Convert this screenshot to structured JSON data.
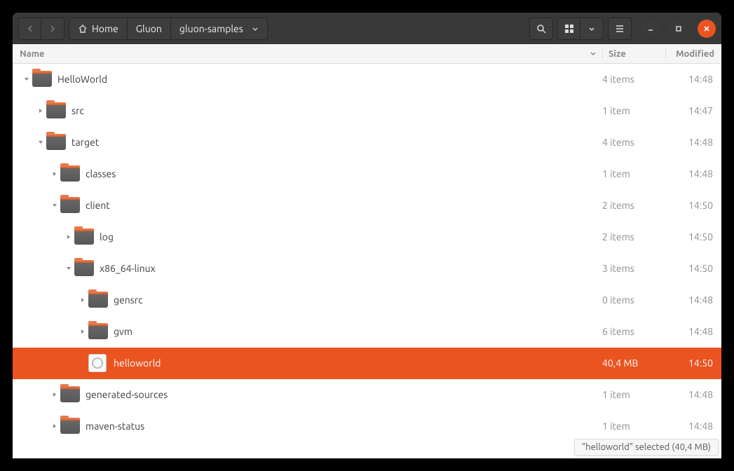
{
  "breadcrumb": {
    "home": "Home",
    "seg1": "Gluon",
    "seg2": "gluon-samples"
  },
  "columns": {
    "name": "Name",
    "size": "Size",
    "modified": "Modified"
  },
  "rows": [
    {
      "indent": 0,
      "expander": "down",
      "icon": "folder",
      "name": "HelloWorld",
      "size": "4 items",
      "mod": "14:48",
      "selected": false
    },
    {
      "indent": 1,
      "expander": "right",
      "icon": "folder",
      "name": "src",
      "size": "1 item",
      "mod": "14:47",
      "selected": false
    },
    {
      "indent": 1,
      "expander": "down",
      "icon": "folder",
      "name": "target",
      "size": "4 items",
      "mod": "14:48",
      "selected": false
    },
    {
      "indent": 2,
      "expander": "right",
      "icon": "folder",
      "name": "classes",
      "size": "1 item",
      "mod": "14:48",
      "selected": false
    },
    {
      "indent": 2,
      "expander": "down",
      "icon": "folder",
      "name": "client",
      "size": "2 items",
      "mod": "14:50",
      "selected": false
    },
    {
      "indent": 3,
      "expander": "right",
      "icon": "folder",
      "name": "log",
      "size": "2 items",
      "mod": "14:50",
      "selected": false
    },
    {
      "indent": 3,
      "expander": "down",
      "icon": "folder",
      "name": "x86_64-linux",
      "size": "3 items",
      "mod": "14:50",
      "selected": false
    },
    {
      "indent": 4,
      "expander": "right",
      "icon": "folder",
      "name": "gensrc",
      "size": "0 items",
      "mod": "14:48",
      "selected": false
    },
    {
      "indent": 4,
      "expander": "right",
      "icon": "folder",
      "name": "gvm",
      "size": "6 items",
      "mod": "14:48",
      "selected": false
    },
    {
      "indent": 4,
      "expander": "none",
      "icon": "exec",
      "name": "helloworld",
      "size": "40,4 MB",
      "mod": "14:50",
      "selected": true
    },
    {
      "indent": 2,
      "expander": "right",
      "icon": "folder",
      "name": "generated-sources",
      "size": "1 item",
      "mod": "14:48",
      "selected": false
    },
    {
      "indent": 2,
      "expander": "right",
      "icon": "folder",
      "name": "maven-status",
      "size": "1 item",
      "mod": "14:48",
      "selected": false
    }
  ],
  "status": "\"helloworld\" selected  (40,4 MB)"
}
